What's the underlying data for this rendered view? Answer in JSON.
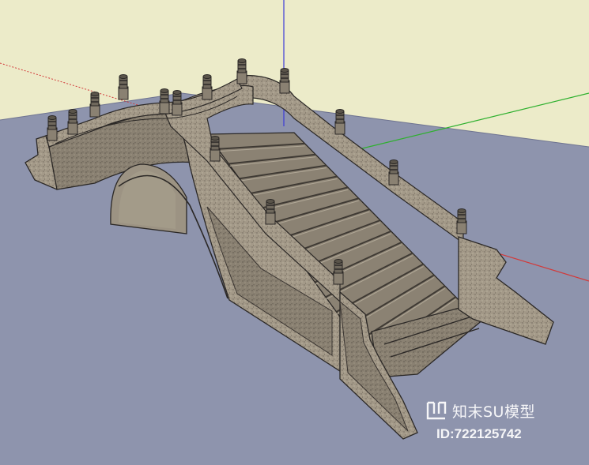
{
  "scene": {
    "subject": "arch-bridge-model",
    "colors": {
      "sky": "#ecebc9",
      "ground": "#8e94ad",
      "stone": "#a49a89",
      "stone_dark": "#7e7566",
      "stone_shadow": "#4c4740",
      "edge": "#2b2826",
      "axis_red": "#d23a3a",
      "axis_green": "#2eb02e",
      "axis_blue": "#3b3bd8"
    },
    "step_count": 16,
    "post_count": 14
  },
  "watermark": {
    "brand": "知末SU模型",
    "id_text": "ID:722125742",
    "logo_icon": "zhimo-logo-icon"
  }
}
